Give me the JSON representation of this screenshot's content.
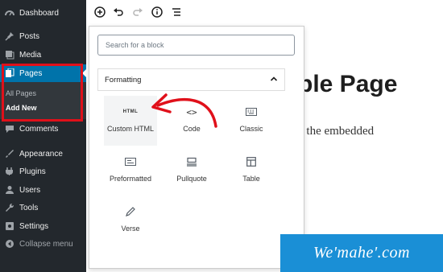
{
  "sidebar": {
    "items": [
      {
        "label": "Dashboard",
        "icon": "dashboard-icon"
      },
      {
        "label": "Posts",
        "icon": "pin-icon"
      },
      {
        "label": "Media",
        "icon": "media-icon"
      },
      {
        "label": "Pages",
        "icon": "pages-icon"
      },
      {
        "label": "Comments",
        "icon": "comments-icon"
      },
      {
        "label": "Appearance",
        "icon": "brush-icon"
      },
      {
        "label": "Plugins",
        "icon": "plugin-icon"
      },
      {
        "label": "Users",
        "icon": "users-icon"
      },
      {
        "label": "Tools",
        "icon": "wrench-icon"
      },
      {
        "label": "Settings",
        "icon": "settings-icon"
      },
      {
        "label": "Collapse menu",
        "icon": "collapse-icon"
      }
    ],
    "submenu": {
      "all_pages": "All Pages",
      "add_new": "Add New"
    }
  },
  "toolbar": {
    "icons": [
      "add-block-icon",
      "undo-icon",
      "redo-icon",
      "info-icon",
      "block-navigation-icon"
    ]
  },
  "inserter": {
    "search_placeholder": "Search for a block",
    "panel_title": "Formatting",
    "blocks": [
      {
        "label": "Custom HTML",
        "icon": "html-icon",
        "glyph": "HTML"
      },
      {
        "label": "Code",
        "icon": "code-icon",
        "glyph": "<>"
      },
      {
        "label": "Classic",
        "icon": "keyboard-icon"
      },
      {
        "label": "Preformatted",
        "icon": "preformatted-icon"
      },
      {
        "label": "Pullquote",
        "icon": "pullquote-icon"
      },
      {
        "label": "Table",
        "icon": "table-icon"
      },
      {
        "label": "Verse",
        "icon": "pen-icon"
      }
    ]
  },
  "editor": {
    "title_fragment": "ple Page",
    "text_fragment": "e the embedded"
  },
  "watermark": "We'mahe'.com",
  "colors": {
    "sidebar": "#23282d",
    "active": "#0073aa",
    "highlight_box": "#e0101a",
    "annotation_arrow": "#e0101a",
    "watermark_bg": "#1a8fd6"
  }
}
